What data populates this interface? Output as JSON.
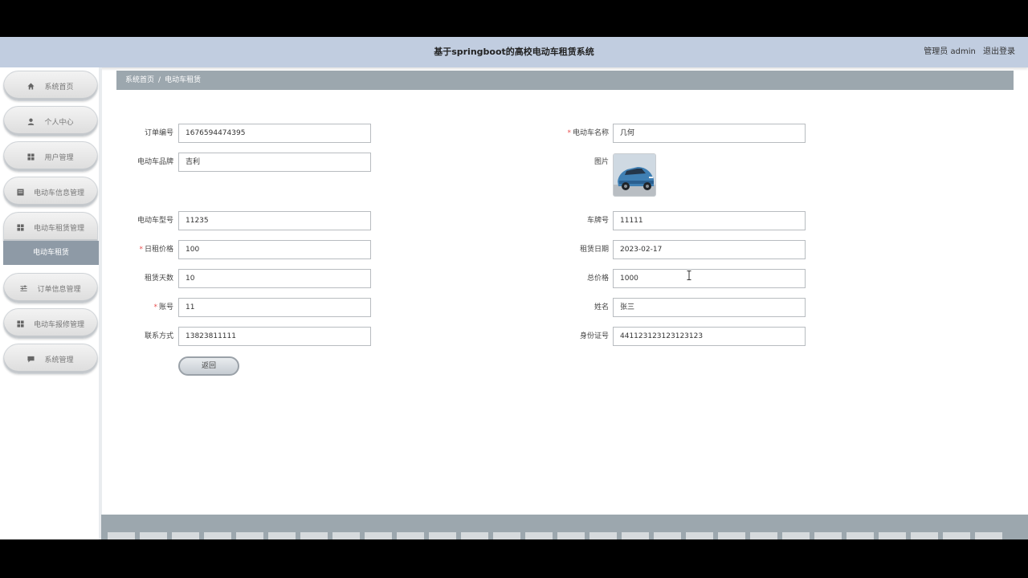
{
  "header": {
    "title": "基于springboot的高校电动车租赁系统",
    "role": "管理员 admin",
    "logout": "退出登录"
  },
  "sidebar": {
    "items": [
      {
        "label": "系统首页",
        "icon": "home-icon"
      },
      {
        "label": "个人中心",
        "icon": "user-icon"
      },
      {
        "label": "用户管理",
        "icon": "grid-icon"
      },
      {
        "label": "电动车信息管理",
        "icon": "doc-icon"
      },
      {
        "label": "电动车租赁管理",
        "icon": "grid-icon"
      },
      {
        "label": "订单信息管理",
        "icon": "sliders-icon"
      },
      {
        "label": "电动车报修管理",
        "icon": "grid-icon"
      },
      {
        "label": "系统管理",
        "icon": "chat-icon"
      }
    ],
    "active_sub": "电动车租赁"
  },
  "breadcrumb": {
    "home": "系统首页",
    "sep": "/",
    "current": "电动车租赁"
  },
  "form": {
    "order_no": {
      "label": "订单编号",
      "value": "1676594474395"
    },
    "car_name": {
      "label": "电动车名称",
      "value": "几何",
      "required": true
    },
    "car_brand": {
      "label": "电动车品牌",
      "value": "吉利"
    },
    "image": {
      "label": "图片"
    },
    "car_model": {
      "label": "电动车型号",
      "value": "11235"
    },
    "plate_no": {
      "label": "车牌号",
      "value": "11111"
    },
    "daily_price": {
      "label": "日租价格",
      "value": "100",
      "required": true
    },
    "rent_date": {
      "label": "租赁日期",
      "value": "2023-02-17"
    },
    "rent_days": {
      "label": "租赁天数",
      "value": "10"
    },
    "total_price": {
      "label": "总价格",
      "value": "1000"
    },
    "account": {
      "label": "账号",
      "value": "11",
      "required": true
    },
    "name": {
      "label": "姓名",
      "value": "张三"
    },
    "phone": {
      "label": "联系方式",
      "value": "13823811111"
    },
    "id_card": {
      "label": "身份证号",
      "value": "441123123123123123"
    },
    "required_mark": "*"
  },
  "buttons": {
    "back": "返回"
  },
  "colors": {
    "header_bg": "#c1cde0",
    "breadcrumb_bg": "#9ca7ae",
    "submenu_active_bg": "#8e9aa6",
    "required": "#e94f4f"
  }
}
